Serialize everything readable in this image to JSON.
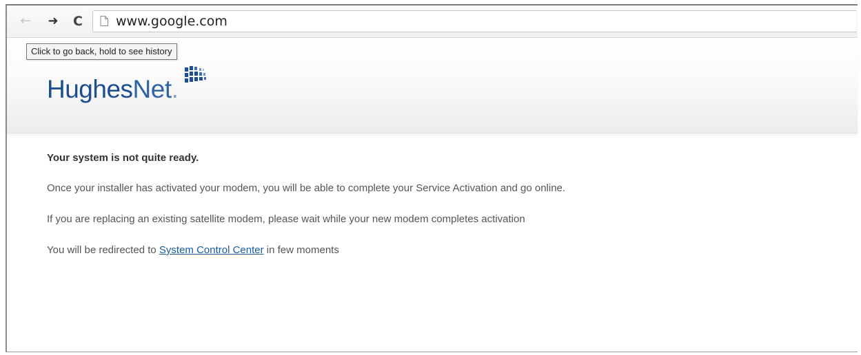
{
  "browser": {
    "url": "www.google.com",
    "back_icon": "arrow-left-icon",
    "forward_icon": "arrow-right-icon",
    "reload_icon": "reload-icon",
    "tooltip": "Click to go back, hold to see history"
  },
  "header": {
    "logo_text_main": "Hughes",
    "logo_text_net": "Net",
    "logo_text_dot": ".",
    "brand_color": "#1d4e8f"
  },
  "content": {
    "heading": "Your system is not quite ready.",
    "para1": "Once your installer has activated your modem, you will be able to complete your Service Activation and go online.",
    "para2": "If you are replacing an existing satellite modem, please wait while your new modem completes activation",
    "para3_before": "You will be redirected to ",
    "para3_link": "System Control Center",
    "para3_after": " in few moments",
    "link_color": "#1a5aa0"
  }
}
